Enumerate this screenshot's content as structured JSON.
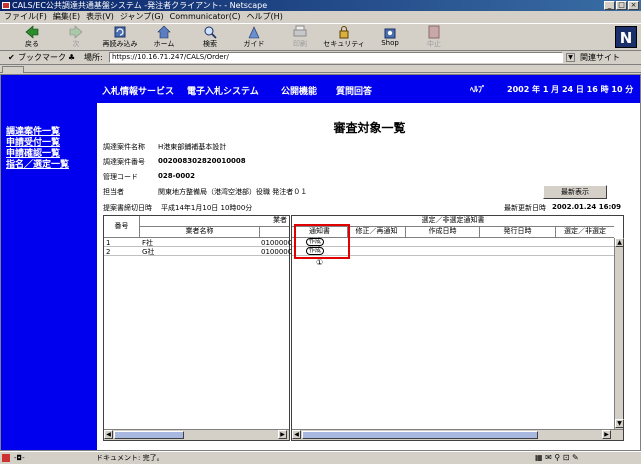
{
  "window": {
    "title": "CALS/EC公共調達共通基盤システム -発注者クライアント- - Netscape",
    "controls": [
      "_",
      "□",
      "×"
    ]
  },
  "menu": [
    "ファイル(F)",
    "編集(E)",
    "表示(V)",
    "ジャンプ(G)",
    "Communicator(C)",
    "ヘルプ(H)"
  ],
  "toolbar": {
    "back": "戻る",
    "forward": "次",
    "reload": "再読み込み",
    "home": "ホーム",
    "search": "検索",
    "guide": "ガイド",
    "print": "印刷",
    "security": "セキュリティ",
    "shop": "Shop",
    "stop": "中止",
    "logo": "N"
  },
  "location": {
    "bookmarks": "ブックマーク",
    "location_label": "場所:",
    "url": "https://10.16.71.247/CALS/Order/",
    "related": "関連サイト"
  },
  "top_nav": [
    "入札情報サービス",
    "電子入札システム",
    "公開機能",
    "質問回答"
  ],
  "help": "ﾍﾙﾌﾟ",
  "date_time": "2002 年  1 月 24 日  16 時 10 分",
  "sidebar": [
    "調達案件一覧",
    "申請受付一覧",
    "申請確認一覧",
    "指名／選定一覧"
  ],
  "page_title": "審査対象一覧",
  "info": {
    "case_name_label": "調達案件名称",
    "case_name": "H港東部鋪補基本設計",
    "case_no_label": "調達案件番号",
    "case_no": "002008302820010008",
    "mgmt_code_label": "管理コード",
    "mgmt_code": "028-0002",
    "person_label": "担当者",
    "person": "関東地方整備局（港湾空港部）役職 発注者０１",
    "deadline_label": "提案書締切日時",
    "deadline": "平成14年1月10日 10時00分",
    "last_update_label": "最新更新日時",
    "last_update": "2002.01.24 16:09",
    "refresh_button": "最新表示"
  },
  "left_grid": {
    "header_group": "業者",
    "col_no": "番号",
    "col_name": "業者名称",
    "rows": [
      {
        "no": "1",
        "name": "F社",
        "code": "0100000"
      },
      {
        "no": "2",
        "name": "G社",
        "code": "0100000"
      }
    ]
  },
  "right_grid": {
    "header_group": "選定／非選定通知書",
    "columns": [
      "通知書",
      "修正／再通知",
      "作成日時",
      "発行日時",
      "選定／非選定"
    ],
    "create_button": "作成",
    "annotation": "①"
  },
  "status": {
    "text": "ドキュメント: 完了。"
  }
}
